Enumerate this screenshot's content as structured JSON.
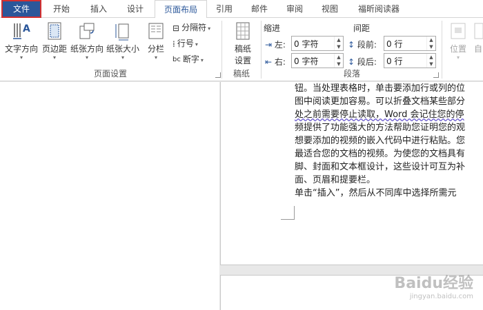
{
  "tabs": [
    {
      "label": "文件",
      "active": false,
      "file": true
    },
    {
      "label": "开始",
      "active": false
    },
    {
      "label": "插入",
      "active": false
    },
    {
      "label": "设计",
      "active": false
    },
    {
      "label": "页面布局",
      "active": true
    },
    {
      "label": "引用",
      "active": false
    },
    {
      "label": "邮件",
      "active": false
    },
    {
      "label": "审阅",
      "active": false
    },
    {
      "label": "视图",
      "active": false
    },
    {
      "label": "福昕阅读器",
      "active": false
    }
  ],
  "page_setup": {
    "label": "页面设置",
    "text_direction": "文字方向",
    "margins": "页边距",
    "orientation": "纸张方向",
    "size": "纸张大小",
    "columns": "分栏",
    "breaks": "分隔符",
    "line_numbers": "行号",
    "hyphenation": "断字"
  },
  "manuscript": {
    "label": "稿纸",
    "button_line1": "稿纸",
    "button_line2": "设置"
  },
  "paragraph": {
    "label": "段落",
    "indent_title": "缩进",
    "spacing_title": "间距",
    "left_label": "左:",
    "right_label": "右:",
    "before_label": "段前:",
    "after_label": "段后:",
    "left_value": "0 字符",
    "right_value": "0 字符",
    "before_value": "0 行",
    "after_value": "0 行"
  },
  "arrange": {
    "position": "位置",
    "wrap": "自"
  },
  "document": {
    "lines": [
      "钮。当处理表格时，单击要添加行或列的位",
      "图中阅读更加容易。可以折叠文档某些部分",
      "处之前需要停止读取，Word 会记住您的停",
      "频提供了功能强大的方法帮助您证明您的观",
      "想要添加的视频的嵌入代码中进行粘贴。您",
      "最适合您的文档的视频。为使您的文档具有",
      "脚、封面和文本框设计，这些设计可互为补",
      "面、页眉和提要栏。",
      "单击“插入”，然后从不同库中选择所需元"
    ]
  },
  "watermark": {
    "text": "Baidu经验",
    "url": "jingyan.baidu.com"
  },
  "colors": {
    "accent": "#2b579a",
    "file_border": "#d32f2f"
  }
}
